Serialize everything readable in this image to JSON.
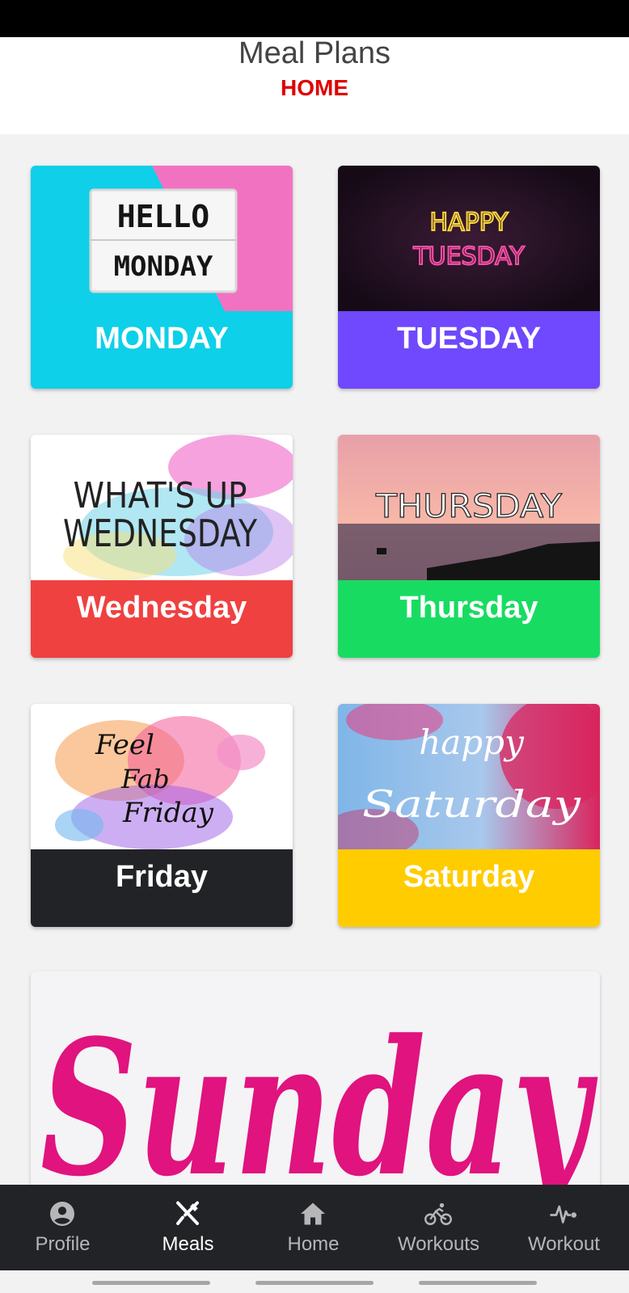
{
  "header": {
    "title": "Meal Plans",
    "subtitle": "HOME"
  },
  "days": [
    {
      "label": "MONDAY",
      "band_color": "#0ed0e8",
      "image_text": [
        "HELLO",
        "MONDAY"
      ]
    },
    {
      "label": "TUESDAY",
      "band_color": "#7048fd",
      "image_text": [
        "HAPPY",
        "TUESDAY"
      ]
    },
    {
      "label": "Wednesday",
      "band_color": "#ef4140",
      "image_text": [
        "WHAT'S UP",
        "WEDNESDAY"
      ]
    },
    {
      "label": "Thursday",
      "band_color": "#18dc62",
      "image_text": [
        "THURSDAY"
      ]
    },
    {
      "label": "Friday",
      "band_color": "#222326",
      "image_text": [
        "Feel",
        "Fab",
        "Friday"
      ]
    },
    {
      "label": "Saturday",
      "band_color": "#ffcc00",
      "image_text": [
        "happy",
        "Saturday"
      ]
    }
  ],
  "sunday": {
    "image_text": "Sunday",
    "color": "#e0137f"
  },
  "nav": [
    {
      "label": "Profile",
      "icon": "account-circle-icon"
    },
    {
      "label": "Meals",
      "icon": "fork-knife-icon",
      "active": true
    },
    {
      "label": "Home",
      "icon": "home-icon"
    },
    {
      "label": "Workouts",
      "icon": "bicycle-icon"
    },
    {
      "label": "Workout",
      "icon": "heart-pulse-icon"
    }
  ]
}
